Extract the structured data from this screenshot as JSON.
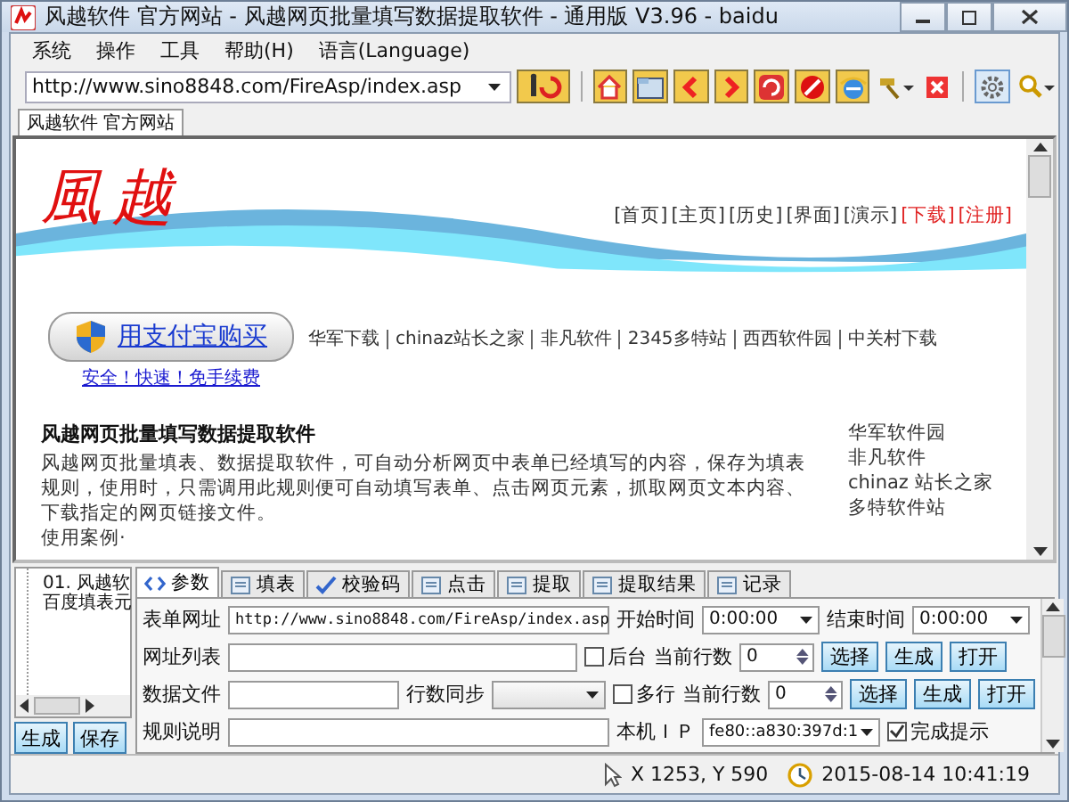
{
  "window": {
    "title": "风越软件 官方网站 - 风越网页批量填写数据提取软件 - 通用版 V3.96 - baidu"
  },
  "menu": [
    "系统",
    "操作",
    "工具",
    "帮助(H)",
    "语言(Language)"
  ],
  "address": {
    "value": "http://www.sino8848.com/FireAsp/index.asp"
  },
  "browser_tabs": [
    {
      "label": "风越软件 官方网站",
      "selected": true
    }
  ],
  "page": {
    "logo": "風越",
    "nav": [
      {
        "label": "[首页]",
        "color": "#333333"
      },
      {
        "label": "[主页]",
        "color": "#333333"
      },
      {
        "label": "[历史]",
        "color": "#333333"
      },
      {
        "label": "[界面]",
        "color": "#333333"
      },
      {
        "label": "[演示]",
        "color": "#333333"
      },
      {
        "label": "[下载]",
        "color": "#e02020"
      },
      {
        "label": "[注册]",
        "color": "#e02020"
      }
    ],
    "pay_button": "用支付宝购买",
    "pay_note": "安全！快速！免手续费",
    "links": [
      "华军下载",
      "chinaz站长之家",
      "非凡软件",
      "2345多特站",
      "西西软件园",
      "中关村下载"
    ],
    "heading": "风越网页批量填写数据提取软件",
    "description": "风越网页批量填表、数据提取软件，可自动分析网页中表单已经填写的内容，保存为填表规则，使用时，只需调用此规则便可自动填写表单、点击网页元素，抓取网页文本内容、下载指定的网页链接文件。",
    "more": "使用案例·",
    "side_links": [
      "华军软件园",
      "非凡软件",
      "chinaz 站长之家",
      "多特软件站"
    ]
  },
  "tree": {
    "items": [
      "01. 风越软",
      "百度填表元"
    ]
  },
  "left_buttons": [
    "生成",
    "保存"
  ],
  "tabs": [
    {
      "label": "参数",
      "selected": true
    },
    {
      "label": "填表",
      "selected": false
    },
    {
      "label": "校验码",
      "selected": false
    },
    {
      "label": "点击",
      "selected": false
    },
    {
      "label": "提取",
      "selected": false
    },
    {
      "label": "提取结果",
      "selected": false
    },
    {
      "label": "记录",
      "selected": false
    }
  ],
  "form": {
    "url_label": "表单网址",
    "url_value": "http://www.sino8848.com/FireAsp/index.asp",
    "start_label": "开始时间",
    "start_value": "0:00:00",
    "end_label": "结束时间",
    "end_value": "0:00:00",
    "rows": [
      {
        "label": "网址列表",
        "kind": "checkbox",
        "option": "后台",
        "checked": false,
        "count_label": "当前行数",
        "count": "0",
        "buttons": [
          "选择",
          "生成",
          "打开"
        ]
      },
      {
        "label": "数据文件",
        "kind": "sync",
        "sync_label": "行数同步",
        "option": "多行",
        "checked": false,
        "count_label": "当前行数",
        "count": "0",
        "buttons": [
          "选择",
          "生成",
          "打开"
        ]
      }
    ],
    "rule_label": "规则说明",
    "ip_label": "本机ＩＰ",
    "ip_value": "fe80::a830:397d:1",
    "notify_label": "完成提示",
    "notify_checked": true
  },
  "status_bar": {
    "cursor": "X 1253, Y 590",
    "datetime": "2015-08-14 10:41:19"
  }
}
